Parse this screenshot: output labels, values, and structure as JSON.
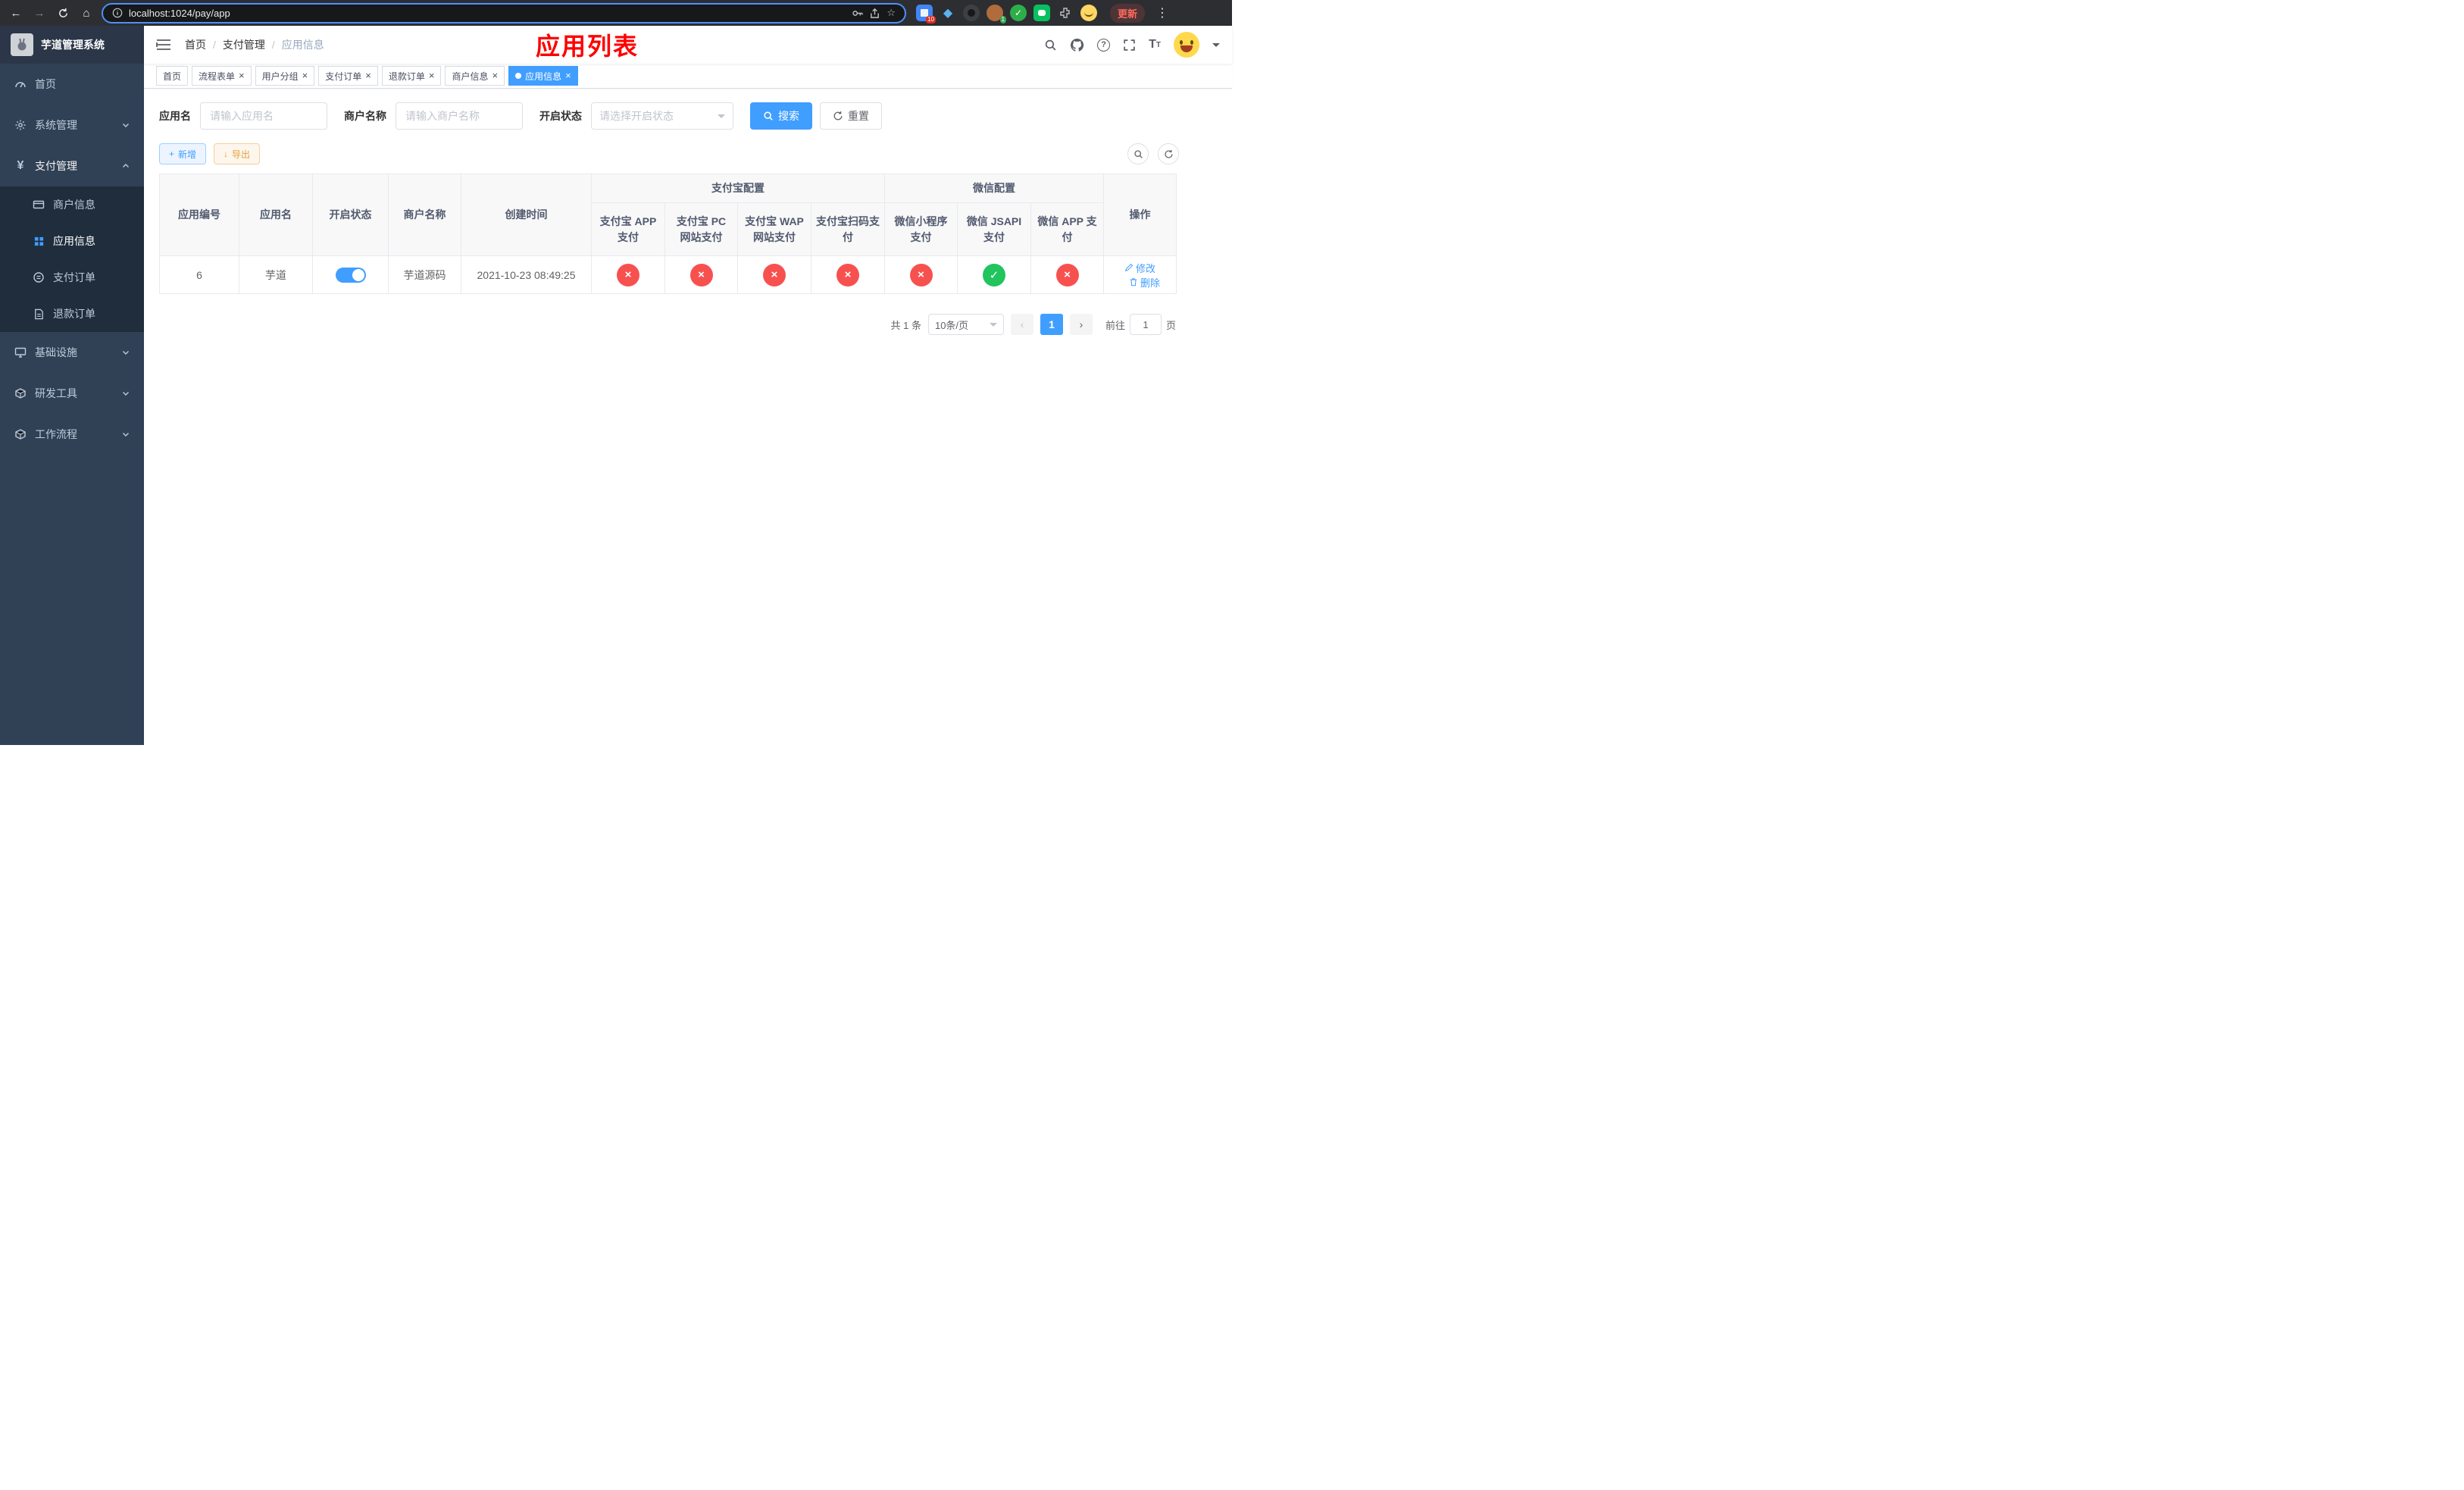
{
  "browser": {
    "url": "localhost:1024/pay/app",
    "update_label": "更新",
    "ext_badge_apps": "10",
    "ext_badge_avatar": "1"
  },
  "icons": {
    "back": "←",
    "forward": "→",
    "home": "⌂",
    "star": "☆",
    "dots": "⋮",
    "close": "×",
    "plus": "+",
    "download": "↓",
    "prev": "‹",
    "next": "›",
    "question": "?",
    "check": "✓",
    "diamond": "◆",
    "fontsize_big": "T",
    "fontsize_small": "T"
  },
  "sidebar": {
    "title": "芋道管理系统",
    "items": [
      {
        "label": "首页"
      },
      {
        "label": "系统管理"
      },
      {
        "label": "支付管理"
      },
      {
        "label": "基础设施"
      },
      {
        "label": "研发工具"
      },
      {
        "label": "工作流程"
      }
    ],
    "submenu": [
      {
        "label": "商户信息"
      },
      {
        "label": "应用信息"
      },
      {
        "label": "支付订单"
      },
      {
        "label": "退款订单"
      }
    ]
  },
  "header": {
    "breadcrumb": [
      {
        "label": "首页"
      },
      {
        "label": "支付管理"
      },
      {
        "label": "应用信息"
      }
    ],
    "overlay_title": "应用列表"
  },
  "tabs": [
    {
      "label": "首页"
    },
    {
      "label": "流程表单"
    },
    {
      "label": "用户分组"
    },
    {
      "label": "支付订单"
    },
    {
      "label": "退款订单"
    },
    {
      "label": "商户信息"
    },
    {
      "label": "应用信息"
    }
  ],
  "filters": {
    "app_name_label": "应用名",
    "app_name_placeholder": "请输入应用名",
    "merchant_label": "商户名称",
    "merchant_placeholder": "请输入商户名称",
    "status_label": "开启状态",
    "status_placeholder": "请选择开启状态",
    "search_label": "搜索",
    "reset_label": "重置"
  },
  "toolbar": {
    "add_label": "新增",
    "export_label": "导出"
  },
  "table": {
    "groups": {
      "alipay": "支付宝配置",
      "wechat": "微信配置"
    },
    "columns": {
      "id": "应用编号",
      "name": "应用名",
      "status": "开启状态",
      "merchant": "商户名称",
      "created": "创建时间",
      "alipay_app": "支付宝 APP 支付",
      "alipay_pc": "支付宝 PC 网站支付",
      "alipay_wap": "支付宝 WAP 网站支付",
      "alipay_qr": "支付宝扫码支付",
      "wx_mini": "微信小程序支付",
      "wx_jsapi": "微信 JSAPI 支付",
      "wx_app": "微信 APP 支付",
      "actions": "操作"
    },
    "row": {
      "id": "6",
      "name": "芋道",
      "status_on": true,
      "merchant": "芋道源码",
      "created": "2021-10-23 08:49:25",
      "alipay_app": "fail",
      "alipay_pc": "fail",
      "alipay_wap": "fail",
      "alipay_qr": "fail",
      "wx_mini": "fail",
      "wx_jsapi": "success",
      "wx_app": "fail"
    },
    "edit_label": "修改",
    "delete_label": "删除"
  },
  "pagination": {
    "total_text": "共 1 条",
    "page_size": "10条/页",
    "page": "1",
    "goto_label": "前往",
    "goto_value": "1",
    "page_unit": "页"
  },
  "colors": {
    "primary": "#409eff",
    "success": "#21c45d",
    "danger": "#f7514f",
    "sidebar_bg": "#304156",
    "submenu_bg": "#1f2d3d",
    "overlay_title_red": "#ff0000",
    "warning": "#e6a23c"
  }
}
